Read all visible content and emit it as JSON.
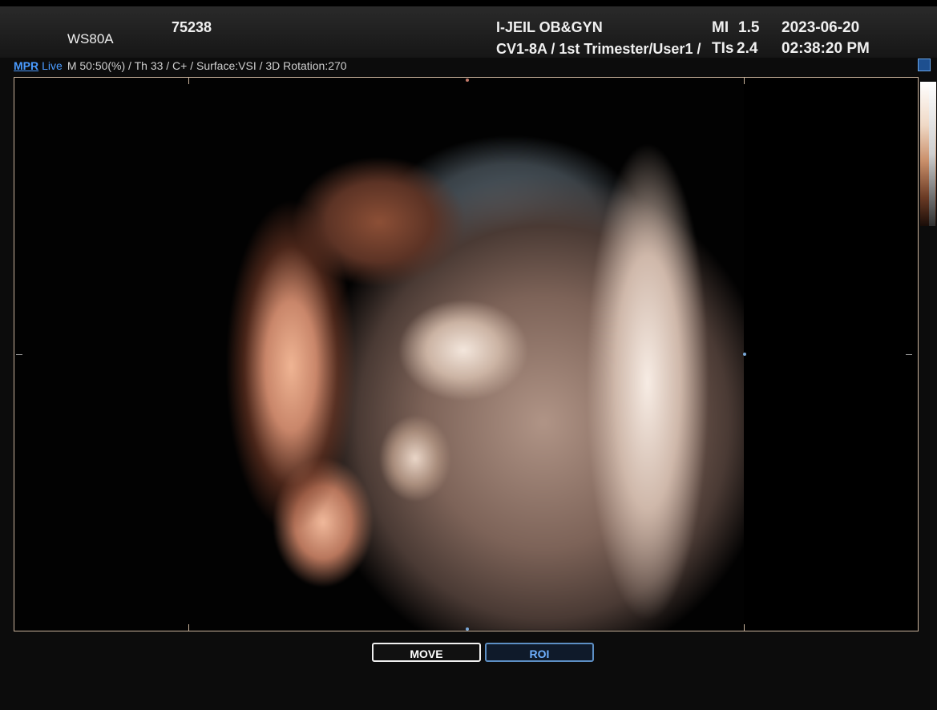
{
  "header": {
    "model": "WS80A",
    "patient_id": "75238",
    "hospital": "I-JEIL OB&GYN",
    "preset": "CV1-8A / 1st Trimester/User1 /",
    "mi_label": "MI",
    "mi_value": "1.5",
    "tis_label": "TIs",
    "tis_value": "2.4",
    "date": "2023-06-20",
    "time": "02:38:20 PM"
  },
  "infobar": {
    "mode_link": "MPR",
    "live": "Live",
    "params": "M 50:50(%) / Th 33 / C+ / Surface:VSI / 3D Rotation:270"
  },
  "buttons": {
    "move": "MOVE",
    "roi": "ROI"
  },
  "icons": {
    "save": "save-icon"
  },
  "colors": {
    "accent_blue": "#4a9bff",
    "roi_blue": "#6fb0ff",
    "viewport_border": "#c9b39c"
  }
}
